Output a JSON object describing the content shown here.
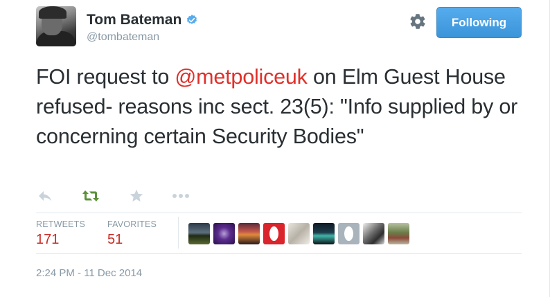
{
  "author": {
    "name": "Tom Bateman",
    "handle": "@tombateman",
    "verified": true
  },
  "header": {
    "settings_icon": "gear-icon",
    "follow_label": "Following"
  },
  "tweet": {
    "text_before": "FOI request to ",
    "mention": "@metpoliceuk",
    "text_after": " on Elm Guest House refused- reasons inc sect. 23(5): \"Info supplied by or concerning certain Security Bodies\""
  },
  "actions": [
    "reply-icon",
    "retweet-icon",
    "favorite-icon",
    "more-icon"
  ],
  "stats": {
    "retweets_label": "RETWEETS",
    "retweets_count": "171",
    "favorites_label": "FAVORITES",
    "favorites_count": "51"
  },
  "favoriters": [
    "avatar-1",
    "avatar-2",
    "avatar-3",
    "avatar-4",
    "avatar-5",
    "avatar-6",
    "avatar-7",
    "avatar-8",
    "avatar-9"
  ],
  "timestamp": "2:24 PM - 11 Dec 2014",
  "colors": {
    "mention": "#e0302a",
    "stat_value": "#cc2a24",
    "follow_button": "#55acee",
    "retweet_active": "#5c913b"
  }
}
